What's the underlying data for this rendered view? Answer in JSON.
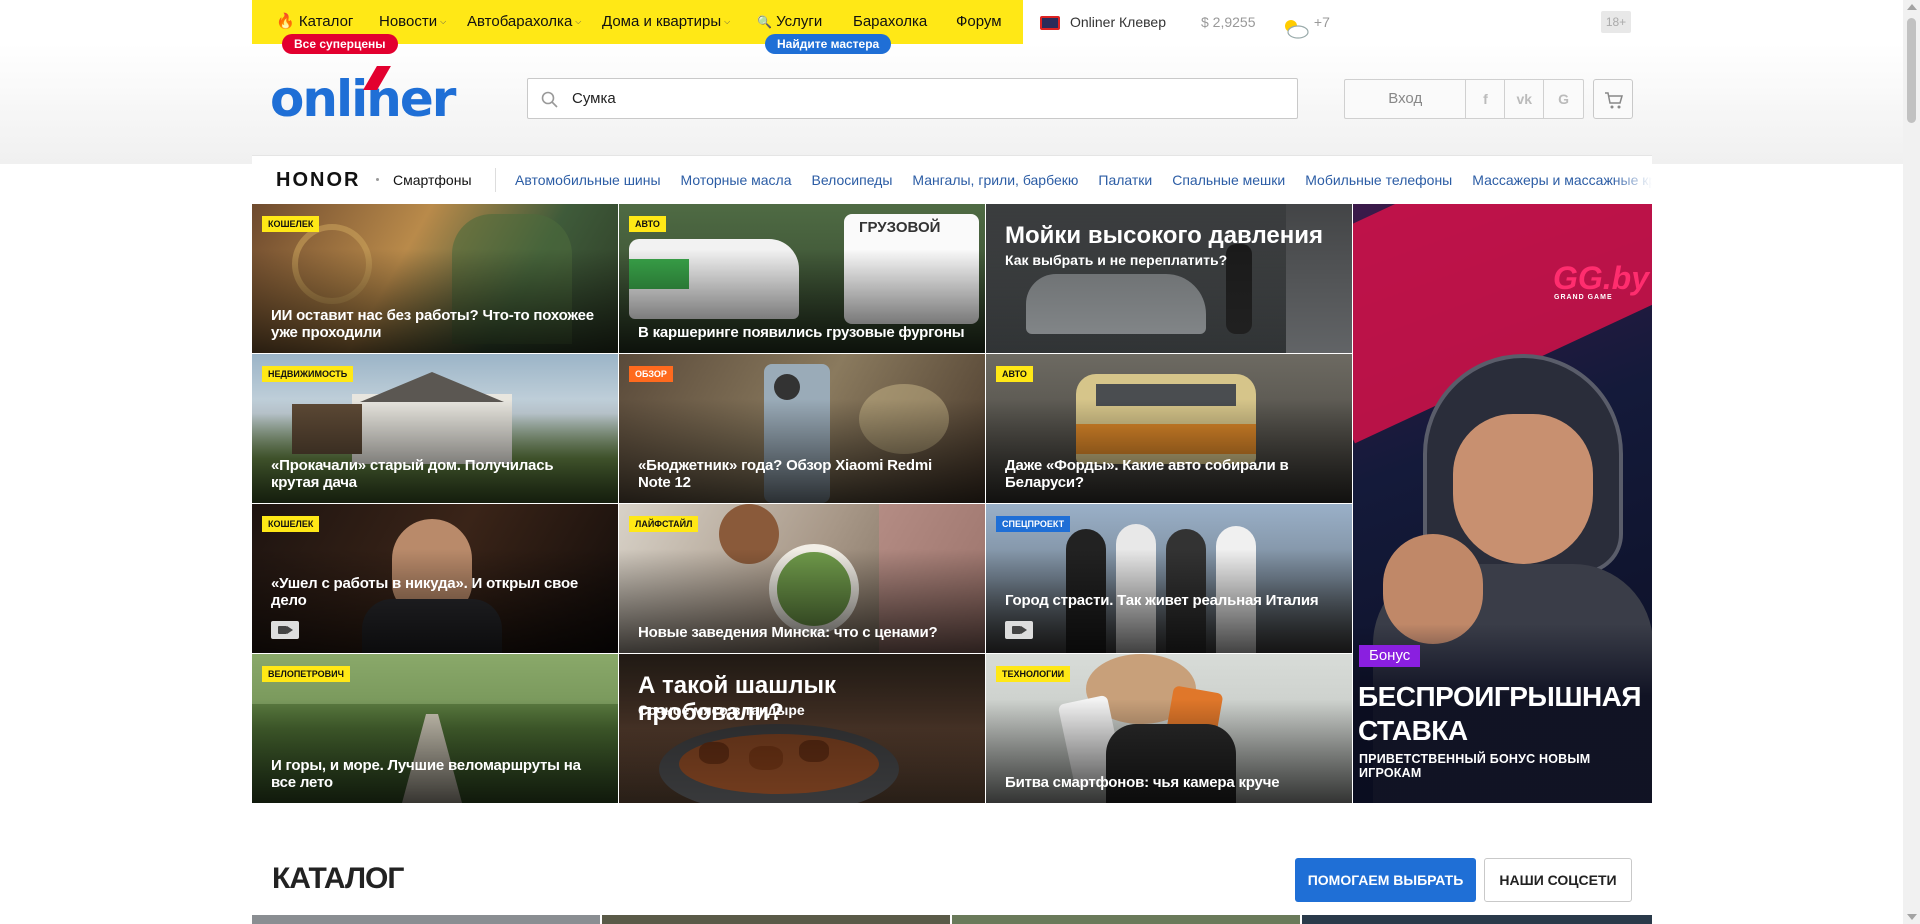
{
  "nav": {
    "catalog": "Каталог",
    "news": "Новости",
    "auto": "Автобарахолка",
    "realty": "Дома и квартиры",
    "services": "Услуги",
    "baraholka": "Барахолка",
    "forum": "Форум",
    "pill_supersale": "Все суперцены",
    "pill_master": "Найдите мастера",
    "clever": "Onliner Клевер",
    "rate": "$ 2,9255",
    "weather": "+7",
    "age": "18+"
  },
  "header": {
    "logo": "onliner",
    "search_value": "Сумка",
    "login": "Вход",
    "social": [
      "f",
      "vk",
      "G"
    ]
  },
  "promo": {
    "brand": "HONOR",
    "brand_category": "Смартфоны",
    "links": [
      "Автомобильные шины",
      "Моторные масла",
      "Велосипеды",
      "Мангалы, грили, барбекю",
      "Палатки",
      "Спальные мешки",
      "Мобильные телефоны",
      "Массажеры и массажные кресла"
    ]
  },
  "tiles": [
    {
      "tag": "Кошелек",
      "title": "ИИ оставит нас без работы? Что-то похожее уже проходили"
    },
    {
      "tag": "Авто",
      "title": "В каршеринге появились грузовые фургоны"
    },
    {
      "big": "Мойки высокого давления",
      "sub": "Как выбрать и не переплатить?"
    },
    {
      "tag": "Недвижимость",
      "title": "«Прокачали» старый дом. Получилась крутая дача"
    },
    {
      "tag": "Обзор",
      "title": "«Бюджетник» года? Обзор Xiaomi Redmi Note 12"
    },
    {
      "tag": "Авто",
      "title": "Даже «Форды». Какие авто собирали в Беларуси?"
    },
    {
      "tag": "Кошелек",
      "title": "«Ушел с работы в никуда». И открыл свое дело"
    },
    {
      "tag": "Лайфстайл",
      "title": "Новые заведения Минска: что с ценами?"
    },
    {
      "tag": "Спецпроект",
      "title": "Город страсти. Так живет реальная Италия"
    },
    {
      "tag": "Велопетрович",
      "title": "И горы, и море. Лучшие веломаршруты на все лето"
    },
    {
      "big": "А такой шашлык пробовали?",
      "sub": "Сочное мясо в тандыре"
    },
    {
      "tag": "Технологии",
      "title": "Битва смартфонов: чья камера круче"
    }
  ],
  "ad": {
    "brand": "GG.by",
    "brand_sub": "GRAND GAME",
    "bonus": "Бонус",
    "headline_1": "БЕСПРОИГРЫШНАЯ",
    "headline_2": "СТАВКА",
    "sub": "ПРИВЕТСТВЕННЫЙ БОНУС НОВЫМ ИГРОКАМ"
  },
  "catalog": {
    "title": "КАТАЛОГ",
    "btn_help": "ПОМОГАЕМ ВЫБРАТЬ",
    "btn_social": "НАШИ СОЦСЕТИ"
  },
  "colors": {
    "yellow": "#ffe816",
    "blue": "#1f6fd6",
    "red": "#e3002f"
  }
}
